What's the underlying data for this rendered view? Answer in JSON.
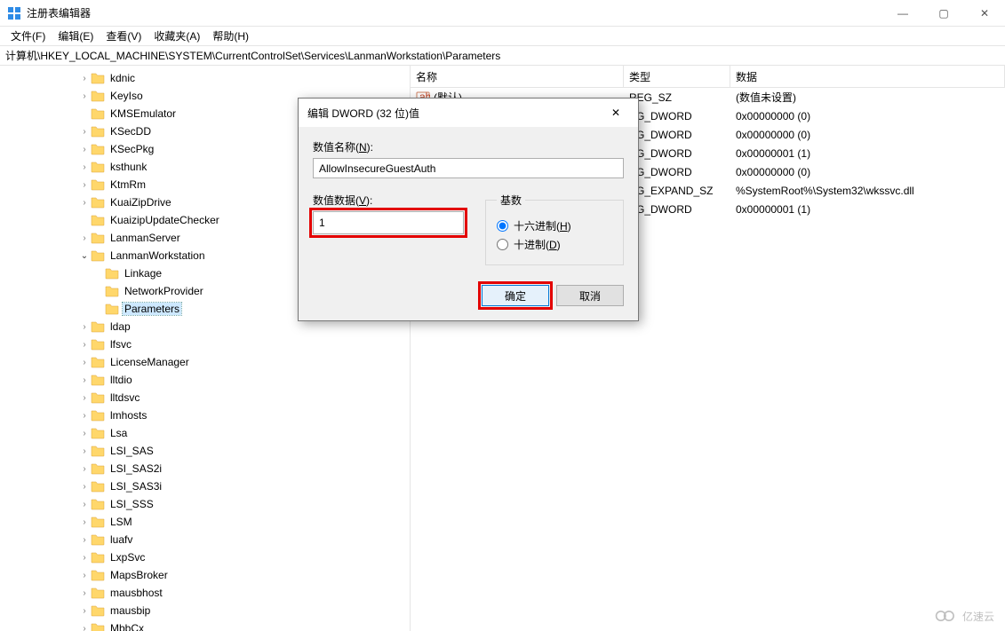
{
  "window": {
    "title": "注册表编辑器",
    "controls": {
      "min": "—",
      "max": "▢",
      "close": "✕"
    }
  },
  "menu": {
    "file": "文件(F)",
    "edit": "编辑(E)",
    "view": "查看(V)",
    "fav": "收藏夹(A)",
    "help": "帮助(H)"
  },
  "address": "计算机\\HKEY_LOCAL_MACHINE\\SYSTEM\\CurrentControlSet\\Services\\LanmanWorkstation\\Parameters",
  "tree": {
    "items": [
      {
        "depth": 5,
        "caret": ">",
        "label": "kdnic"
      },
      {
        "depth": 5,
        "caret": ">",
        "label": "KeyIso"
      },
      {
        "depth": 5,
        "caret": "",
        "label": "KMSEmulator"
      },
      {
        "depth": 5,
        "caret": ">",
        "label": "KSecDD"
      },
      {
        "depth": 5,
        "caret": ">",
        "label": "KSecPkg"
      },
      {
        "depth": 5,
        "caret": ">",
        "label": "ksthunk"
      },
      {
        "depth": 5,
        "caret": ">",
        "label": "KtmRm"
      },
      {
        "depth": 5,
        "caret": ">",
        "label": "KuaiZipDrive"
      },
      {
        "depth": 5,
        "caret": "",
        "label": "KuaizipUpdateChecker"
      },
      {
        "depth": 5,
        "caret": ">",
        "label": "LanmanServer"
      },
      {
        "depth": 5,
        "caret": "v",
        "label": "LanmanWorkstation"
      },
      {
        "depth": 6,
        "caret": "",
        "label": "Linkage"
      },
      {
        "depth": 6,
        "caret": "",
        "label": "NetworkProvider"
      },
      {
        "depth": 6,
        "caret": "",
        "label": "Parameters",
        "selected": true
      },
      {
        "depth": 5,
        "caret": ">",
        "label": "ldap"
      },
      {
        "depth": 5,
        "caret": ">",
        "label": "lfsvc"
      },
      {
        "depth": 5,
        "caret": ">",
        "label": "LicenseManager"
      },
      {
        "depth": 5,
        "caret": ">",
        "label": "lltdio"
      },
      {
        "depth": 5,
        "caret": ">",
        "label": "lltdsvc"
      },
      {
        "depth": 5,
        "caret": ">",
        "label": "lmhosts"
      },
      {
        "depth": 5,
        "caret": ">",
        "label": "Lsa"
      },
      {
        "depth": 5,
        "caret": ">",
        "label": "LSI_SAS"
      },
      {
        "depth": 5,
        "caret": ">",
        "label": "LSI_SAS2i"
      },
      {
        "depth": 5,
        "caret": ">",
        "label": "LSI_SAS3i"
      },
      {
        "depth": 5,
        "caret": ">",
        "label": "LSI_SSS"
      },
      {
        "depth": 5,
        "caret": ">",
        "label": "LSM"
      },
      {
        "depth": 5,
        "caret": ">",
        "label": "luafv"
      },
      {
        "depth": 5,
        "caret": ">",
        "label": "LxpSvc"
      },
      {
        "depth": 5,
        "caret": ">",
        "label": "MapsBroker"
      },
      {
        "depth": 5,
        "caret": ">",
        "label": "mausbhost"
      },
      {
        "depth": 5,
        "caret": ">",
        "label": "mausbip"
      },
      {
        "depth": 5,
        "caret": ">",
        "label": "MbbCx"
      }
    ]
  },
  "list": {
    "headers": {
      "name": "名称",
      "type": "类型",
      "data": "数据"
    },
    "rows": [
      {
        "icon": "str",
        "name": "(默认)",
        "type": "REG_SZ",
        "data": "(数值未设置)"
      },
      {
        "icon": "bin",
        "name": "",
        "type": "EG_DWORD",
        "data": "0x00000000 (0)"
      },
      {
        "icon": "bin",
        "name": "",
        "type": "EG_DWORD",
        "data": "0x00000000 (0)"
      },
      {
        "icon": "bin",
        "name": "",
        "type": "EG_DWORD",
        "data": "0x00000001 (1)"
      },
      {
        "icon": "bin",
        "name": "",
        "type": "EG_DWORD",
        "data": "0x00000000 (0)"
      },
      {
        "icon": "str",
        "name": "",
        "type": "EG_EXPAND_SZ",
        "data": "%SystemRoot%\\System32\\wkssvc.dll"
      },
      {
        "icon": "bin",
        "name": "",
        "type": "EG_DWORD",
        "data": "0x00000001 (1)"
      }
    ]
  },
  "dialog": {
    "title": "编辑 DWORD (32 位)值",
    "close": "✕",
    "name_label": "数值名称(N):",
    "name_value": "AllowInsecureGuestAuth",
    "data_label": "数值数据(V):",
    "data_value": "1",
    "radix_label": "基数",
    "radix_hex": "十六进制(H)",
    "radix_dec": "十进制(D)",
    "ok": "确定",
    "cancel": "取消"
  },
  "watermark": "亿速云"
}
